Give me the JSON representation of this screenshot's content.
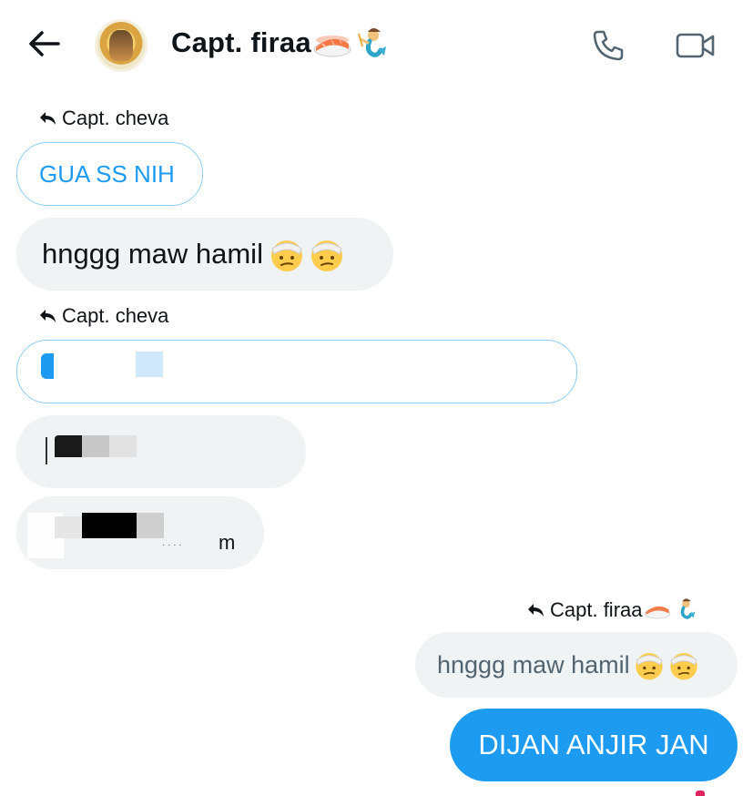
{
  "header": {
    "back_label": "Back",
    "contact_name": "Capt. firaa",
    "name_emojis": [
      "sushi-emoji",
      "merman-emoji"
    ],
    "call_icon": "phone-icon",
    "video_icon": "video-camera-icon"
  },
  "messages": [
    {
      "reply_to": "Capt. cheva",
      "text": "GUA SS NIH"
    },
    {
      "text": "hnggg maw hamil"
    },
    {
      "reply_to": "Capt. cheva",
      "text": ""
    },
    {
      "text": ""
    },
    {
      "text": "m"
    },
    {
      "reply_to": "Capt. firaa",
      "text": "hnggg maw hamil"
    },
    {
      "text": "DIJAN ANJIR JAN"
    }
  ],
  "colors": {
    "accent": "#1d9bf0",
    "bubble_gray": "#eff3f4",
    "outline": "#8ecdf5",
    "text": "#0f1419"
  }
}
